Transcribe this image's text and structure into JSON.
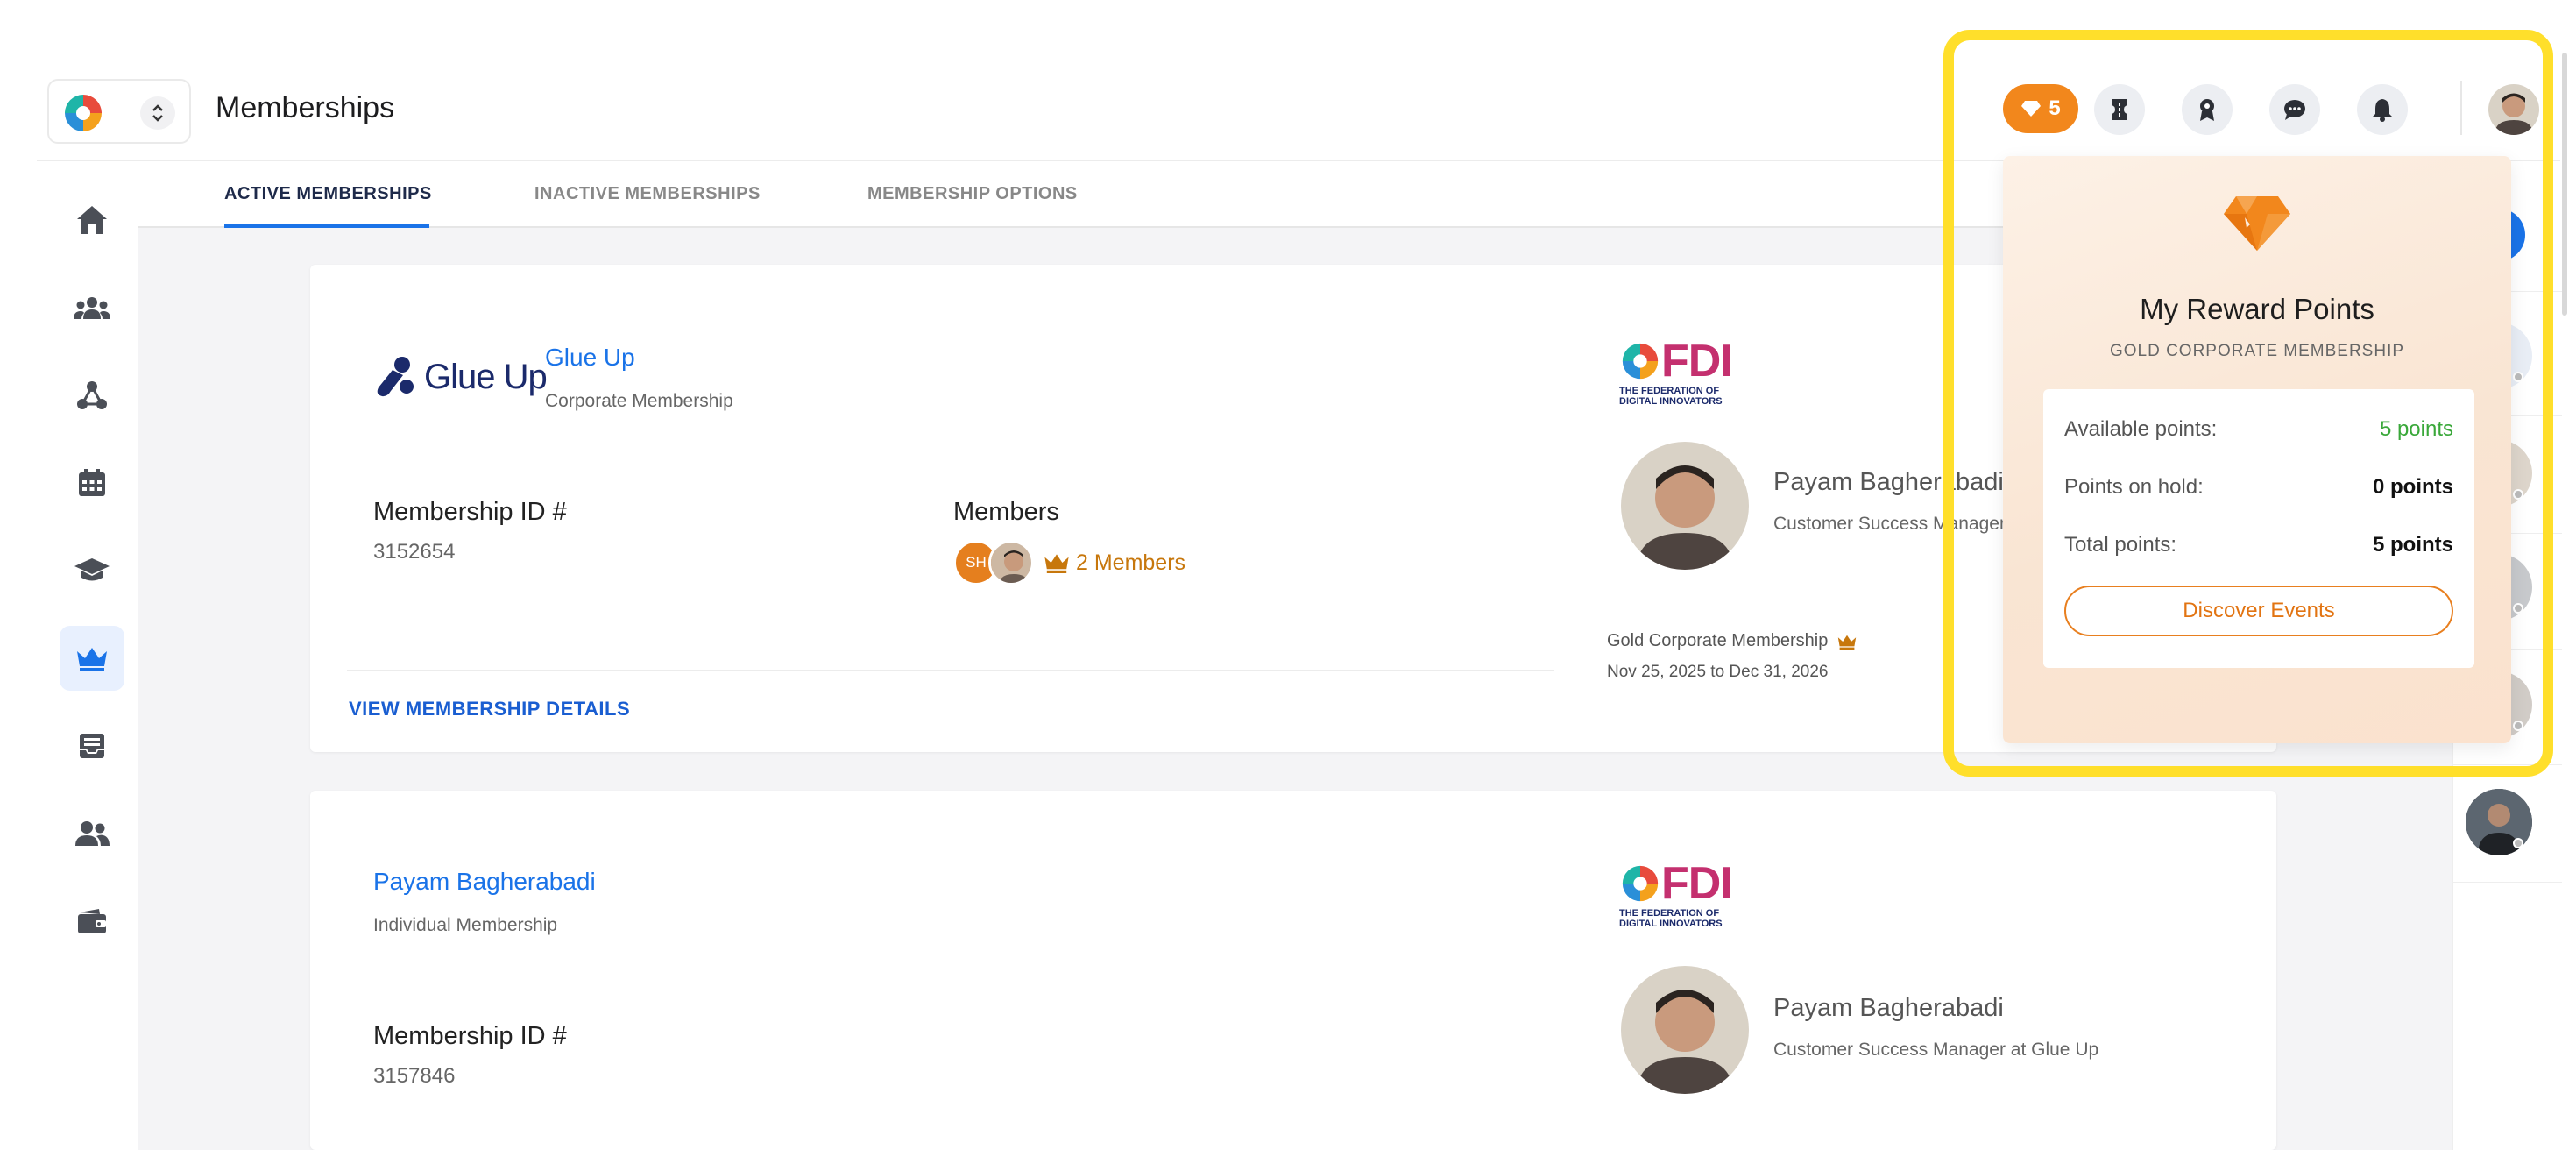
{
  "header": {
    "title": "Memberships"
  },
  "tabs": [
    {
      "label": "ACTIVE MEMBERSHIPS",
      "active": true
    },
    {
      "label": "INACTIVE MEMBERSHIPS",
      "active": false
    },
    {
      "label": "MEMBERSHIP OPTIONS",
      "active": false
    }
  ],
  "nav": [
    {
      "name": "home-icon"
    },
    {
      "name": "community-icon"
    },
    {
      "name": "network-icon"
    },
    {
      "name": "calendar-icon"
    },
    {
      "name": "graduation-cap-icon"
    },
    {
      "name": "crown-icon",
      "active": true
    },
    {
      "name": "inbox-icon"
    },
    {
      "name": "people-icon"
    },
    {
      "name": "wallet-icon"
    }
  ],
  "memberships": [
    {
      "org_name": "Glue Up",
      "org_logo_text": "Glue Up",
      "type": "Corporate Membership",
      "id_label": "Membership ID #",
      "id": "3152654",
      "members_label": "Members",
      "member_initials": "SH",
      "members_count": "2 Members",
      "contact_name": "Payam Bagherabadi",
      "contact_role": "Customer Success Manager at Glue Up",
      "tier": "Gold Corporate Membership",
      "period": "Nov 25, 2025 to Dec 31, 2026",
      "details_link": "VIEW MEMBERSHIP DETAILS"
    },
    {
      "org_name": "Payam Bagherabadi",
      "type": "Individual Membership",
      "id_label": "Membership ID #",
      "id": "3157846",
      "contact_name": "Payam Bagherabadi",
      "contact_role": "Customer Success Manager at Glue Up"
    }
  ],
  "fdi": {
    "text": "FDI",
    "tagline_1": "THE FEDERATION OF",
    "tagline_2": "DIGITAL INNOVATORS"
  },
  "rewards": {
    "badge_count": "5",
    "title": "My Reward Points",
    "subtitle": "GOLD CORPORATE MEMBERSHIP",
    "rows": [
      {
        "label": "Available points:",
        "value": "5 points"
      },
      {
        "label": "Points on hold:",
        "value": "0 points"
      },
      {
        "label": "Total points:",
        "value": "5 points"
      }
    ],
    "button": "Discover Events"
  },
  "colors": {
    "accent": "#1a73e8",
    "reward_orange": "#f2871c",
    "highlight": "#ffdf2b",
    "points_green": "#3aa83a"
  }
}
